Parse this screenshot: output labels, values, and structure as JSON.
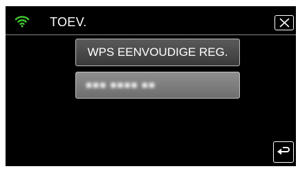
{
  "header": {
    "wifi_icon": "wifi-icon",
    "wifi_color": "#3fbf2f",
    "title": "TOEV.",
    "close_icon": "close-icon"
  },
  "buttons": {
    "wps_label": "WPS EENVOUDIGE REG.",
    "network_label": "■■■ ■■■■ ■■",
    "back_icon": "return-icon"
  }
}
